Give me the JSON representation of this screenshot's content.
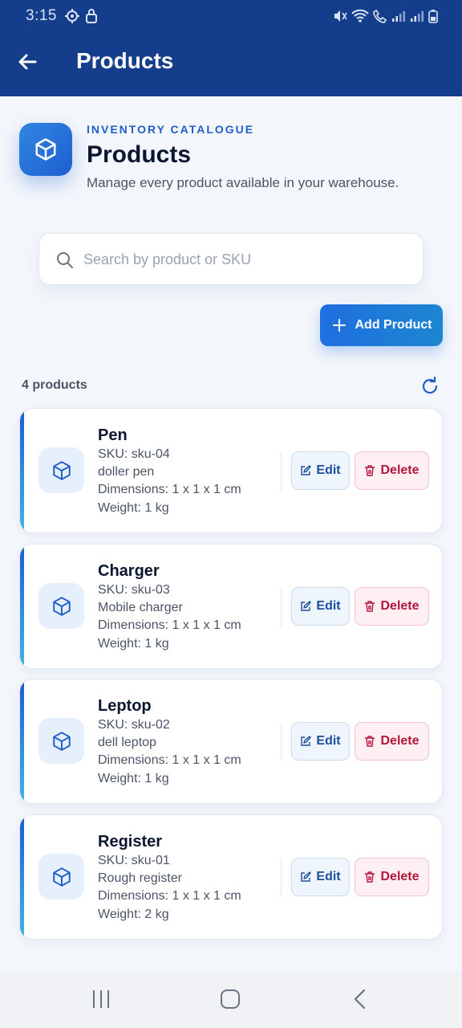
{
  "status_bar": {
    "time": "3:15"
  },
  "app_bar": {
    "title": "Products",
    "back_icon": "arrow-left-icon"
  },
  "header": {
    "eyebrow": "INVENTORY CATALOGUE",
    "title": "Products",
    "subtitle": "Manage every product available in your warehouse.",
    "icon": "cube-icon"
  },
  "search": {
    "placeholder": "Search by product or SKU",
    "value": ""
  },
  "actions": {
    "add_label": "Add Product"
  },
  "list": {
    "count_label": "4 products",
    "edit_label": "Edit",
    "delete_label": "Delete",
    "items": [
      {
        "name": "Pen",
        "sku": "SKU: sku-04",
        "description": "doller pen",
        "dimensions": "Dimensions: 1 x 1 x 1 cm",
        "weight": "Weight: 1 kg"
      },
      {
        "name": "Charger",
        "sku": "SKU: sku-03",
        "description": "Mobile charger",
        "dimensions": "Dimensions: 1 x 1 x 1 cm",
        "weight": "Weight: 1 kg"
      },
      {
        "name": "Leptop",
        "sku": "SKU: sku-02",
        "description": "dell leptop",
        "dimensions": "Dimensions: 1 x 1 x 1 cm",
        "weight": "Weight: 1 kg"
      },
      {
        "name": "Register",
        "sku": "SKU: sku-01",
        "description": "Rough register",
        "dimensions": "Dimensions: 1 x 1 x 1 cm",
        "weight": "Weight: 2 kg"
      }
    ]
  },
  "colors": {
    "app_bar": "#143d8c",
    "accent": "#1f6fe0",
    "danger": "#b3163b",
    "background": "#f3f6fb"
  }
}
